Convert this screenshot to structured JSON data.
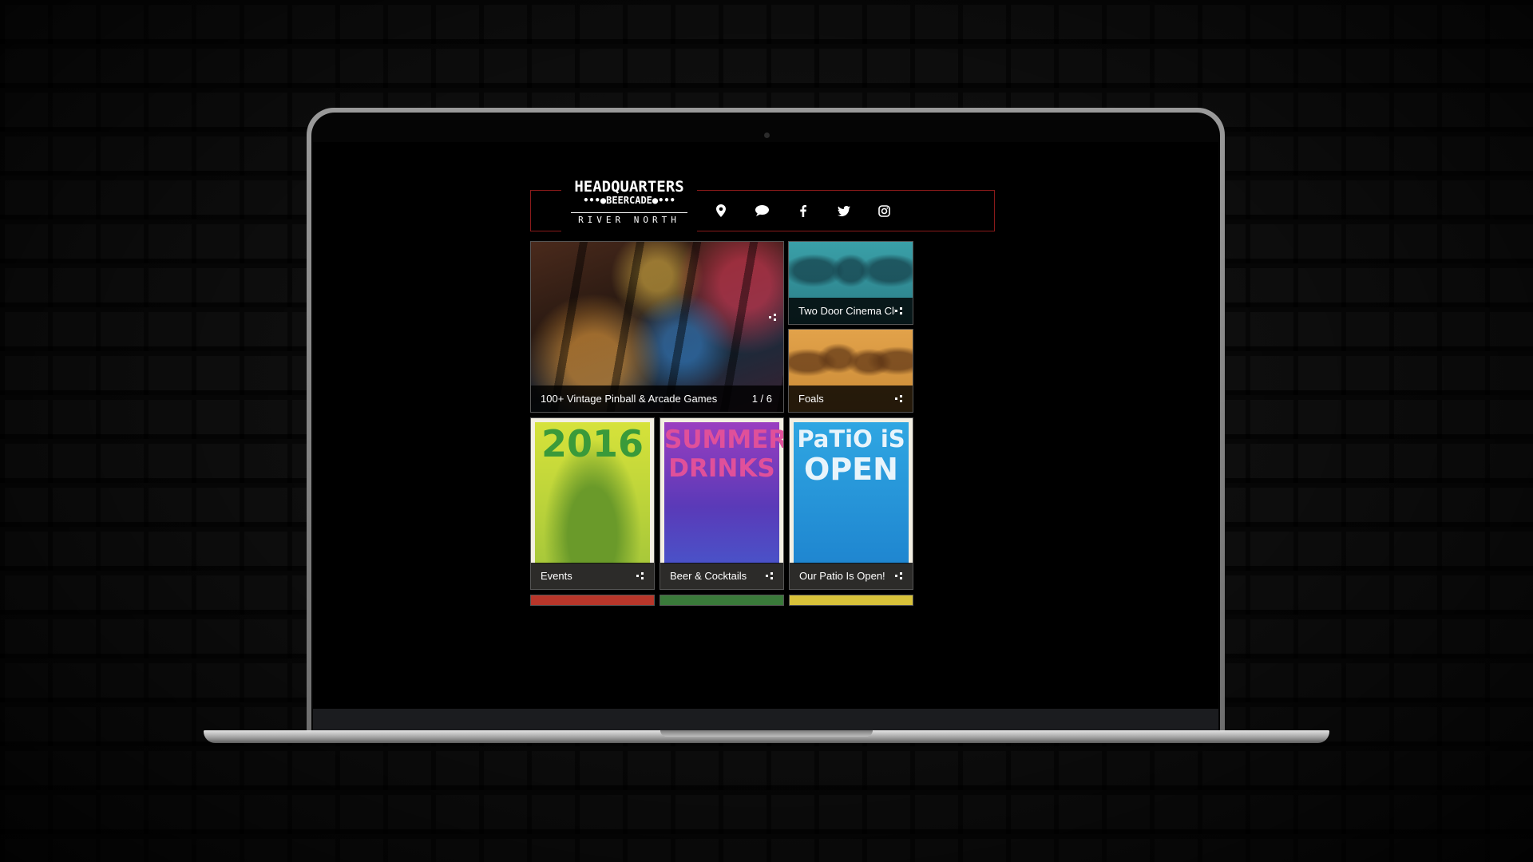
{
  "site": {
    "logo": {
      "main": "HEADQUARTERS",
      "sub": "•••●BEERCADE●•••",
      "location": "RIVER NORTH"
    },
    "nav": [
      {
        "icon": "map-pin-icon"
      },
      {
        "icon": "chat-bubble-icon"
      },
      {
        "icon": "facebook-icon"
      },
      {
        "icon": "twitter-icon"
      },
      {
        "icon": "instagram-icon"
      }
    ],
    "hero": {
      "caption": "100+ Vintage Pinball & Arcade Games",
      "counter": "1 / 6"
    },
    "side_tiles": [
      {
        "caption": "Two Door Cinema Club"
      },
      {
        "caption": "Foals"
      }
    ],
    "posters": [
      {
        "caption": "Events",
        "art_text": "2016"
      },
      {
        "caption": "Beer & Cocktails",
        "art_text_1": "SUMMER",
        "art_text_2": "DRINKS"
      },
      {
        "caption": "Our Patio Is Open!",
        "art_text_1": "PaTiO iS",
        "art_text_2": "OPEN"
      }
    ]
  },
  "colors": {
    "header_border": "#8a1a1a",
    "events_bg": "#b9d435",
    "drinks_bg": "#7a3fb0",
    "patio_bg": "#2a9fd8"
  }
}
